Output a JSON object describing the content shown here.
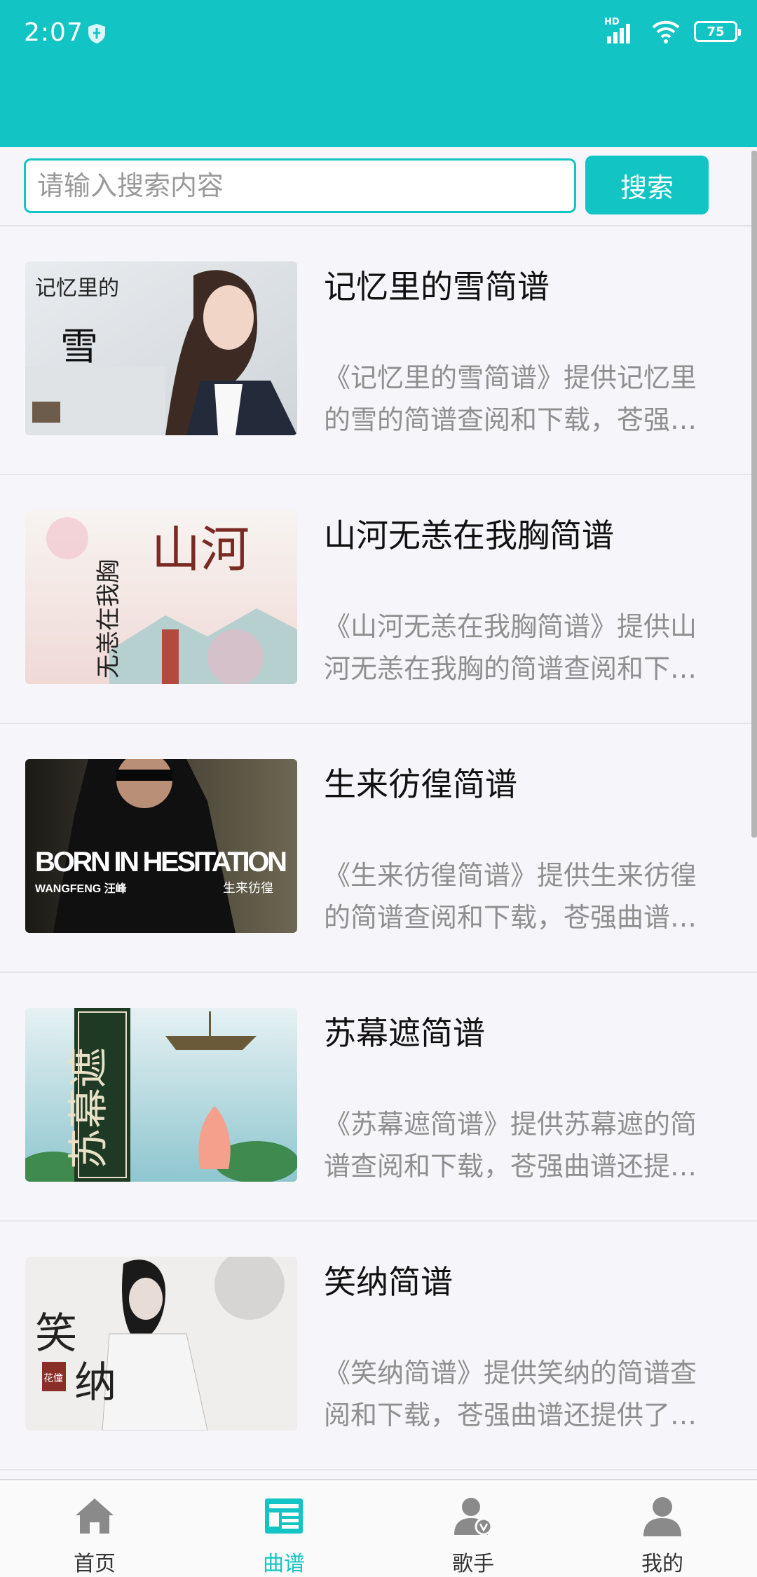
{
  "status_bar": {
    "time": "2:07",
    "battery": "75",
    "network": "HD"
  },
  "search": {
    "placeholder": "请输入搜索内容",
    "button_label": "搜索"
  },
  "items": [
    {
      "title": "记忆里的雪简谱",
      "desc_line1": "《记忆里的雪简谱》提供记忆里",
      "desc_line2": "的雪的简谱查阅和下载，苍强…",
      "thumb_text_a": "记忆里的",
      "thumb_text_b": "雪"
    },
    {
      "title": "山河无恙在我胸简谱",
      "desc_line1": "《山河无恙在我胸简谱》提供山",
      "desc_line2": "河无恙在我胸的简谱查阅和下…",
      "thumb_text_a": "山河",
      "thumb_text_b": "无恙在我胸"
    },
    {
      "title": "生来彷徨简谱",
      "desc_line1": "《生来彷徨简谱》提供生来彷徨",
      "desc_line2": "的简谱查阅和下载，苍强曲谱…",
      "thumb_text_a": "BORN IN HESITATION",
      "thumb_text_b": "WANGFENG 汪峰",
      "thumb_text_c": "生来彷徨"
    },
    {
      "title": "苏幕遮简谱",
      "desc_line1": "《苏幕遮简谱》提供苏幕遮的简",
      "desc_line2": "谱查阅和下载，苍强曲谱还提…",
      "thumb_text_a": "苏幕遮"
    },
    {
      "title": "笑纳简谱",
      "desc_line1": "《笑纳简谱》提供笑纳的简谱查",
      "desc_line2": "阅和下载，苍强曲谱还提供了…",
      "thumb_text_a": "笑",
      "thumb_text_b": "纳",
      "thumb_text_c": "花僮"
    }
  ],
  "tabs": [
    {
      "label": "首页",
      "icon": "home-icon",
      "active": false
    },
    {
      "label": "曲谱",
      "icon": "score-icon",
      "active": true
    },
    {
      "label": "歌手",
      "icon": "singer-icon",
      "active": false
    },
    {
      "label": "我的",
      "icon": "profile-icon",
      "active": false
    }
  ],
  "colors": {
    "accent": "#13c4c4",
    "inactive_icon": "#8a8a8a"
  }
}
